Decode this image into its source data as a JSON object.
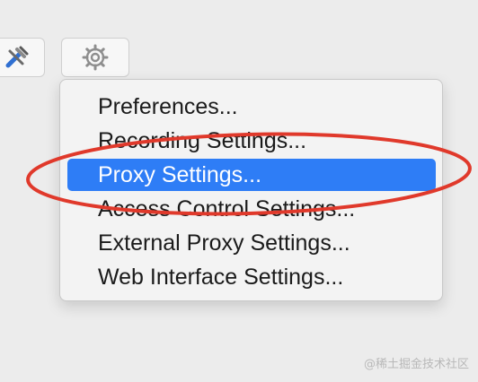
{
  "toolbar": {
    "tools_icon": "tools-icon",
    "settings_icon": "gear-icon"
  },
  "menu": {
    "items": [
      {
        "label": "Preferences..."
      },
      {
        "label": "Recording Settings..."
      },
      {
        "label": "Proxy Settings...",
        "selected": true
      },
      {
        "label": "Access Control Settings..."
      },
      {
        "label": "External Proxy Settings..."
      },
      {
        "label": "Web Interface Settings..."
      }
    ]
  },
  "annotation": {
    "color": "#e0392b",
    "target": "Proxy Settings..."
  },
  "watermark": "@稀土掘金技术社区",
  "colors": {
    "selection": "#2e7df6",
    "background": "#ececec"
  }
}
